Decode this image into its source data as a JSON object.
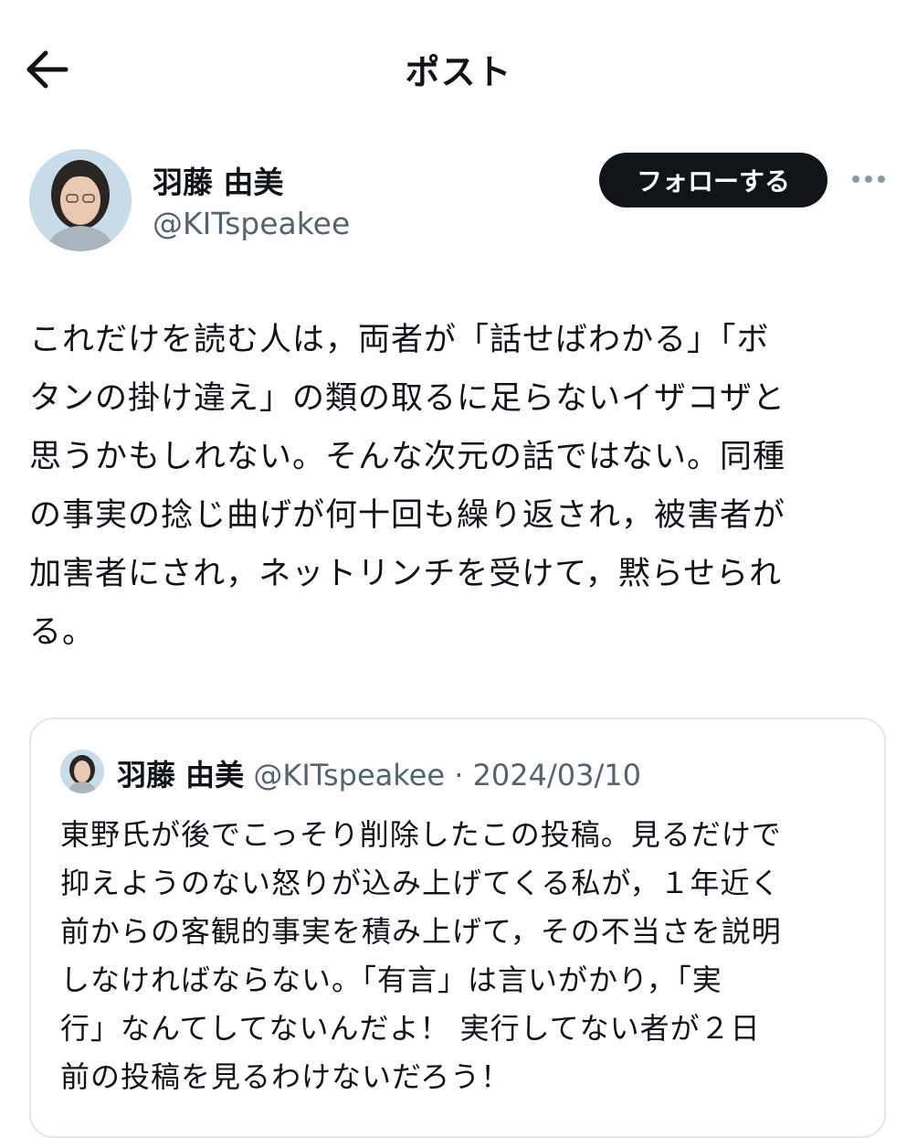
{
  "header": {
    "title": "ポスト"
  },
  "author": {
    "display_name": "羽藤 由美",
    "handle": "@KITspeakee",
    "follow_label": "フォローする"
  },
  "post": {
    "text": "これだけを読む人は，両者が「話せばわかる」「ボ\nタンの掛け違え」の類の取るに足らないイザコザと\n思うかもしれない。そんな次元の話ではない。同種\nの事実の捻じ曲げが何十回も繰り返され，被害者が\n加害者にされ，ネットリンチを受けて，黙らせられ\nる。"
  },
  "quoted_post": {
    "display_name": "羽藤 由美",
    "handle": "@KITspeakee",
    "separator": "·",
    "date": "2024/03/10",
    "text": "東野氏が後でこっそり削除したこの投稿。見るだけで\n抑えようのない怒りが込み上げてくる私が，１年近く\n前からの客観的事実を積み上げて，その不当さを説明\nしなければならない。「有言」は言いがかり，「実\n行」なんてしてないんだよ！ 実行してない者が２日\n前の投稿を見るわけないだろう！"
  },
  "icons": {
    "back": "arrow-left-icon",
    "more": "more-horizontal-icon"
  },
  "colors": {
    "text": "#0f1419",
    "secondary": "#536471",
    "border": "#e1e8ed",
    "button": "#0f1419"
  }
}
